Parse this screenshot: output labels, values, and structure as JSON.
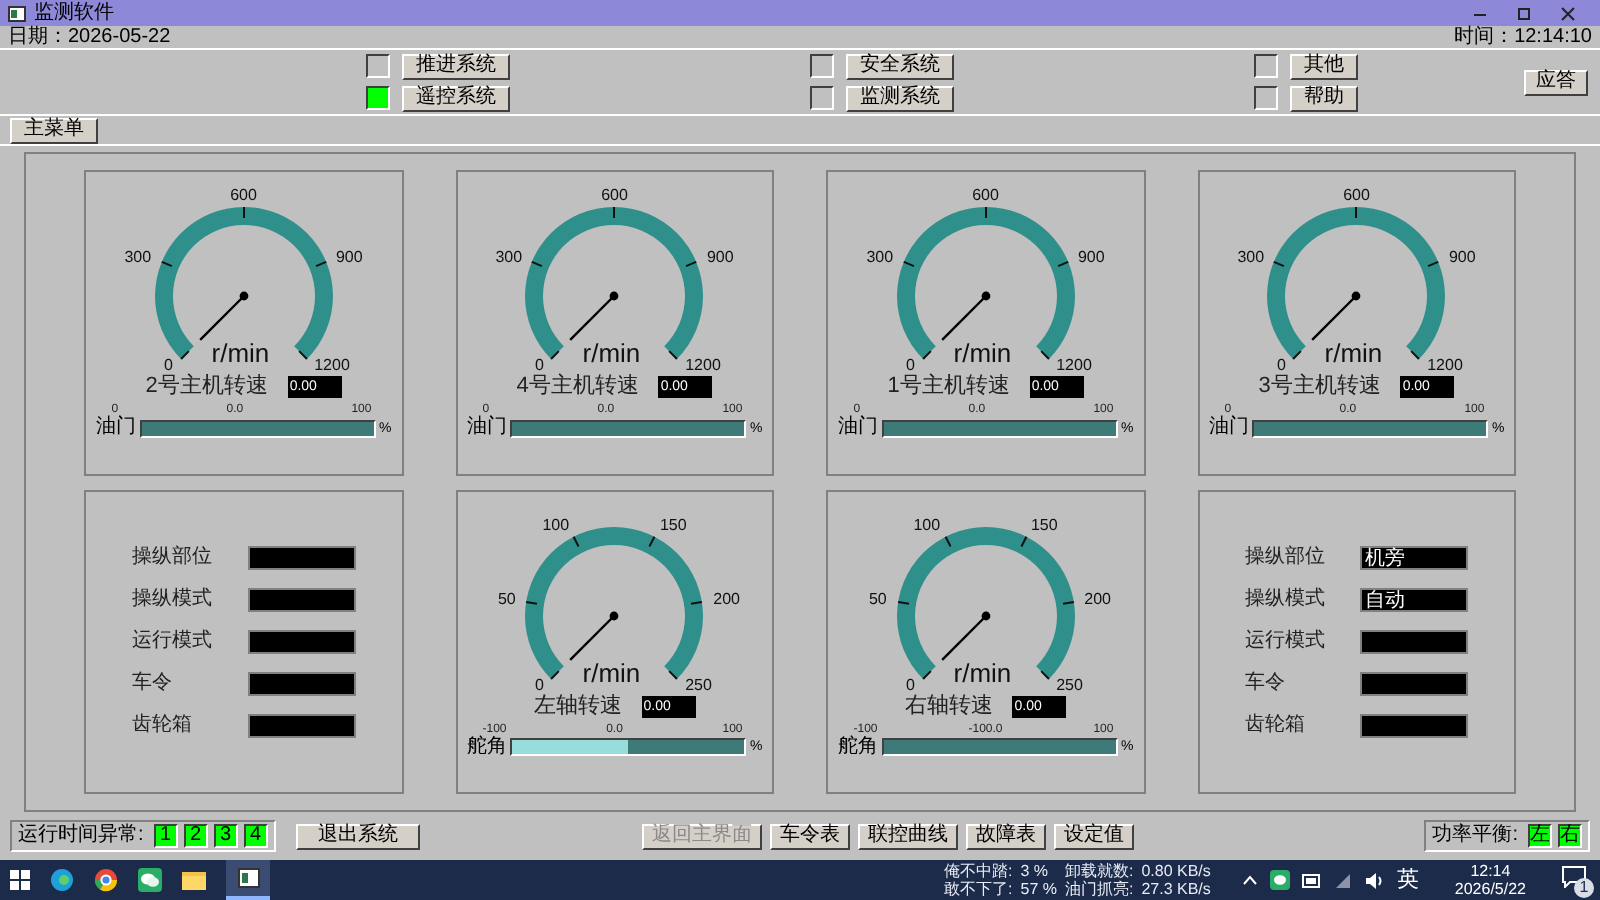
{
  "window": {
    "title": "监测软件"
  },
  "info_bar": {
    "date": "日期：2026-05-22",
    "time": "时间：12:14:10"
  },
  "system_buttons": [
    {
      "label": "推进系统",
      "on": false
    },
    {
      "label": "遥控系统",
      "on": true
    },
    {
      "label": "安全系统",
      "on": false
    },
    {
      "label": "监测系统",
      "on": false
    },
    {
      "label": "其他",
      "on": false
    },
    {
      "label": "帮助",
      "on": false
    }
  ],
  "ack_button": "应答",
  "menu_button": "主菜单",
  "panels": [
    {
      "kind": "gauge",
      "title": "2号主机转速",
      "value": "0.00",
      "unit": "r/min",
      "ticks": [
        "0",
        "300",
        "600",
        "900",
        "1200"
      ],
      "bar": {
        "label": "油门",
        "min": "0",
        "mid": "0.0",
        "max": "100",
        "unit": "%",
        "level": 0
      }
    },
    {
      "kind": "gauge",
      "title": "4号主机转速",
      "value": "0.00",
      "unit": "r/min",
      "ticks": [
        "0",
        "300",
        "600",
        "900",
        "1200"
      ],
      "bar": {
        "label": "油门",
        "min": "0",
        "mid": "0.0",
        "max": "100",
        "unit": "%",
        "level": 0
      }
    },
    {
      "kind": "gauge",
      "title": "1号主机转速",
      "value": "0.00",
      "unit": "r/min",
      "ticks": [
        "0",
        "300",
        "600",
        "900",
        "1200"
      ],
      "bar": {
        "label": "油门",
        "min": "0",
        "mid": "0.0",
        "max": "100",
        "unit": "%",
        "level": 0
      }
    },
    {
      "kind": "gauge",
      "title": "3号主机转速",
      "value": "0.00",
      "unit": "r/min",
      "ticks": [
        "0",
        "300",
        "600",
        "900",
        "1200"
      ],
      "bar": {
        "label": "油门",
        "min": "0",
        "mid": "0.0",
        "max": "100",
        "unit": "%",
        "level": 0
      }
    },
    {
      "kind": "info",
      "rows": [
        {
          "label": "操纵部位"
        },
        {
          "label": "操纵模式"
        },
        {
          "label": "运行模式"
        },
        {
          "label": "车令"
        },
        {
          "label": "齿轮箱"
        }
      ]
    },
    {
      "kind": "gauge",
      "title": "左轴转速",
      "value": "0.00",
      "unit": "r/min",
      "ticks": [
        "0",
        "50",
        "100",
        "150",
        "200",
        "250"
      ],
      "bar": {
        "label": "舵角",
        "min": "-100",
        "mid": "0.0",
        "max": "100",
        "unit": "%",
        "level": 0.5
      }
    },
    {
      "kind": "gauge",
      "title": "右轴转速",
      "value": "0.00",
      "unit": "r/min",
      "ticks": [
        "0",
        "50",
        "100",
        "150",
        "200",
        "250"
      ],
      "bar": {
        "label": "舵角",
        "min": "-100",
        "mid": "-100.0",
        "max": "100",
        "unit": "%",
        "level": 0
      }
    },
    {
      "kind": "info",
      "rows": [
        {
          "label": "操纵部位",
          "value": "机旁"
        },
        {
          "label": "操纵模式",
          "value": "自动"
        },
        {
          "label": "运行模式"
        },
        {
          "label": "车令"
        },
        {
          "label": "齿轮箱"
        }
      ]
    }
  ],
  "fault_indicator": {
    "label": "运行时间异常:",
    "lights": [
      {
        "label": "1",
        "on": true
      },
      {
        "label": "2",
        "on": true
      },
      {
        "label": "3",
        "on": true
      },
      {
        "label": "4",
        "on": true
      }
    ]
  },
  "exit_button": "退出系统",
  "nav_buttons": [
    {
      "label": "返回主界面",
      "disabled": true
    },
    {
      "label": "车令表",
      "disabled": false
    },
    {
      "label": "联控曲线",
      "disabled": false
    },
    {
      "label": "故障表",
      "disabled": false
    },
    {
      "label": "设定值",
      "disabled": false
    }
  ],
  "power_balance": {
    "label": "功率平衡:",
    "lights": [
      {
        "label": "左",
        "on": true
      },
      {
        "label": "右",
        "on": true
      }
    ]
  },
  "taskbar": {
    "widget": [
      "俺不中踏:",
      "3 %",
      "卸载就数:",
      "0.80 KB/s",
      "敢不下了:",
      "57 %",
      "油门抓亮:",
      "27.3 KB/s"
    ],
    "input_method": "英",
    "clock_time": "12:14",
    "clock_date": "2026/5/22",
    "notification_count": "1"
  }
}
